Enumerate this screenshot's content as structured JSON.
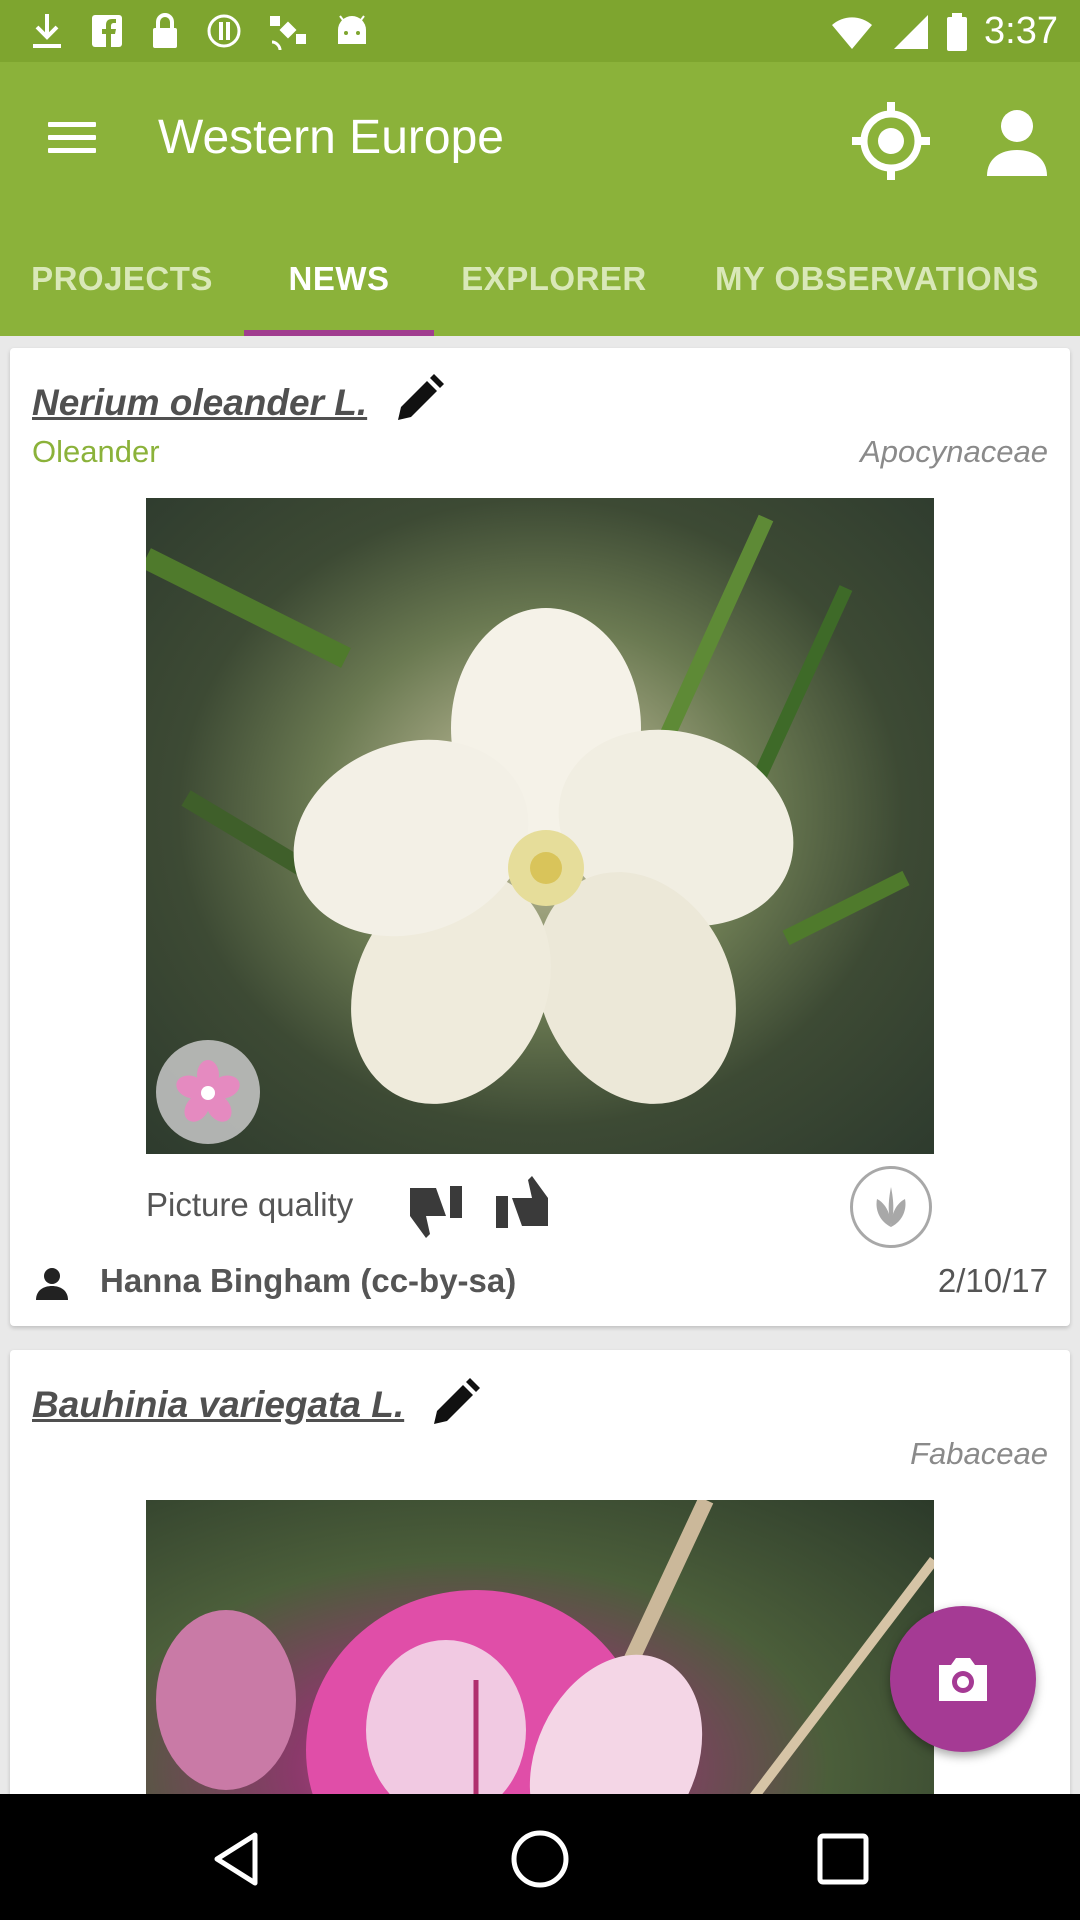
{
  "status_bar": {
    "time": "3:37",
    "left_icons": [
      "download-icon",
      "facebook-icon",
      "lock-icon",
      "alert-icon",
      "satellite-icon",
      "android-icon"
    ]
  },
  "app_bar": {
    "title": "Western Europe",
    "background_color": "#8bb23a",
    "tabs": [
      {
        "label": "PROJECTS",
        "active": false
      },
      {
        "label": "NEWS",
        "active": true
      },
      {
        "label": "EXPLORER",
        "active": false
      },
      {
        "label": "MY OBSERVATIONS",
        "active": false
      }
    ],
    "indicator_color": "#a03d8f"
  },
  "observations": [
    {
      "scientific_name": "Nerium oleander L.",
      "common_name": "Oleander",
      "family": "Apocynaceae",
      "picture_quality_label": "Picture quality",
      "author": "Hanna Bingham (cc-by-sa)",
      "date": "2/10/17"
    },
    {
      "scientific_name": "Bauhinia variegata L.",
      "common_name": "",
      "family": "Fabaceae"
    }
  ],
  "fab_color": "#a53a94"
}
